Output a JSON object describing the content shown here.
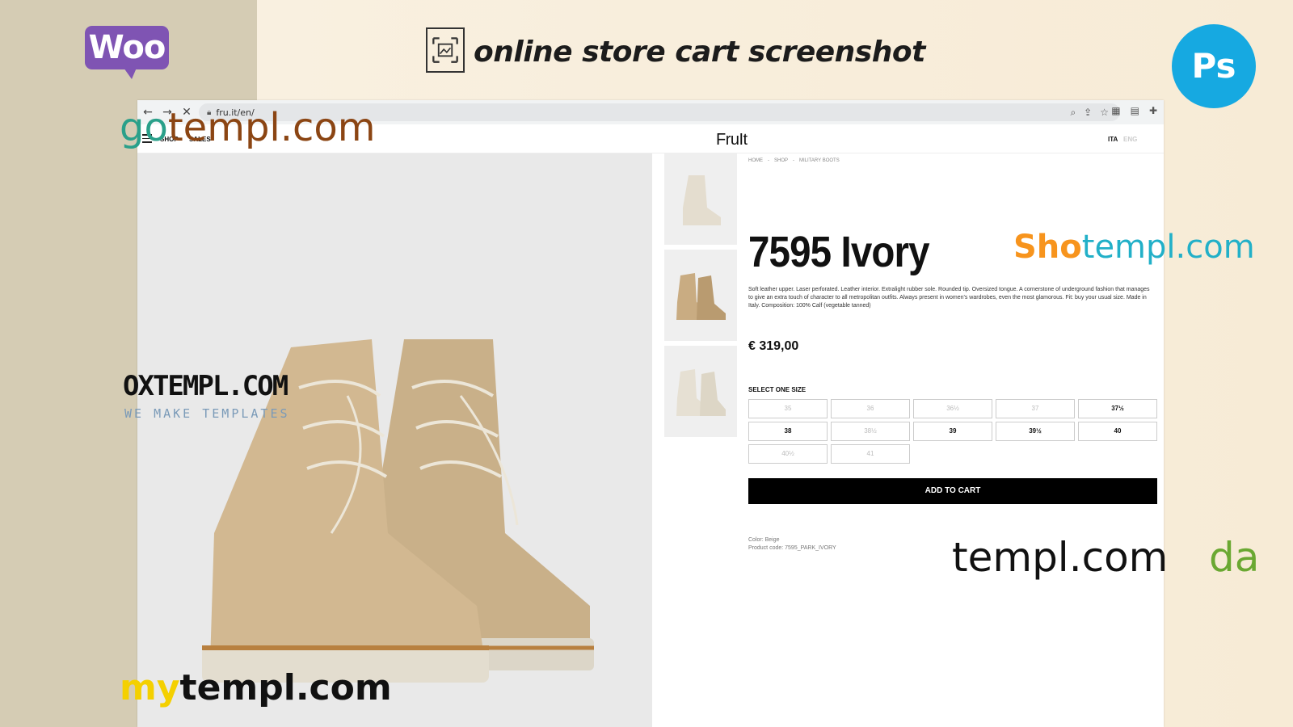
{
  "header": {
    "woo_logo_text": "Woo",
    "title": "online store cart screenshot",
    "ps_logo_text": "Ps"
  },
  "browser": {
    "url": "fru.it/en/"
  },
  "site": {
    "nav": [
      "SHOP",
      "SALES"
    ],
    "logo": "FruIt",
    "lang_active": "ITA",
    "lang_inactive": "ENG"
  },
  "product": {
    "breadcrumb": [
      "HOME",
      "SHOP",
      "MILITARY BOOTS"
    ],
    "title": "7595 Ivory",
    "description": "Soft leather upper. Laser perforated. Leather interior. Extralight rubber sole. Rounded tip. Oversized tongue. A cornerstone of underground fashion that manages to give an extra touch of character to all metropolitan outfits. Always present in women's wardrobes, even the most glamorous. Fit: buy your usual size. Made in Italy. Composition: 100% Calf (vegetable tanned)",
    "price": "€ 319,00",
    "size_label": "SELECT ONE SIZE",
    "sizes": [
      {
        "label": "35",
        "available": false
      },
      {
        "label": "36",
        "available": false
      },
      {
        "label": "36½",
        "available": false
      },
      {
        "label": "37",
        "available": false
      },
      {
        "label": "37½",
        "available": true
      },
      {
        "label": "38",
        "available": true
      },
      {
        "label": "38½",
        "available": false
      },
      {
        "label": "39",
        "available": true
      },
      {
        "label": "39½",
        "available": true
      },
      {
        "label": "40",
        "available": true
      },
      {
        "label": "40½",
        "available": false
      },
      {
        "label": "41",
        "available": false
      }
    ],
    "add_to_cart": "ADD TO CART",
    "color": "Color: Beige",
    "code": "Product code: 7595_PARK_IVORY"
  },
  "watermarks": {
    "gotempl_a": "go",
    "gotempl_b": "templ.com",
    "shotempl_a": "Sho",
    "shotempl_b": "templ.com",
    "oxtempl": "OXTEMPL.COM",
    "oxtempl_sub": "WE MAKE TEMPLATES",
    "templ": "templ.com",
    "da": "da",
    "mytempl_a": "my",
    "mytempl_b": "templ.com"
  }
}
